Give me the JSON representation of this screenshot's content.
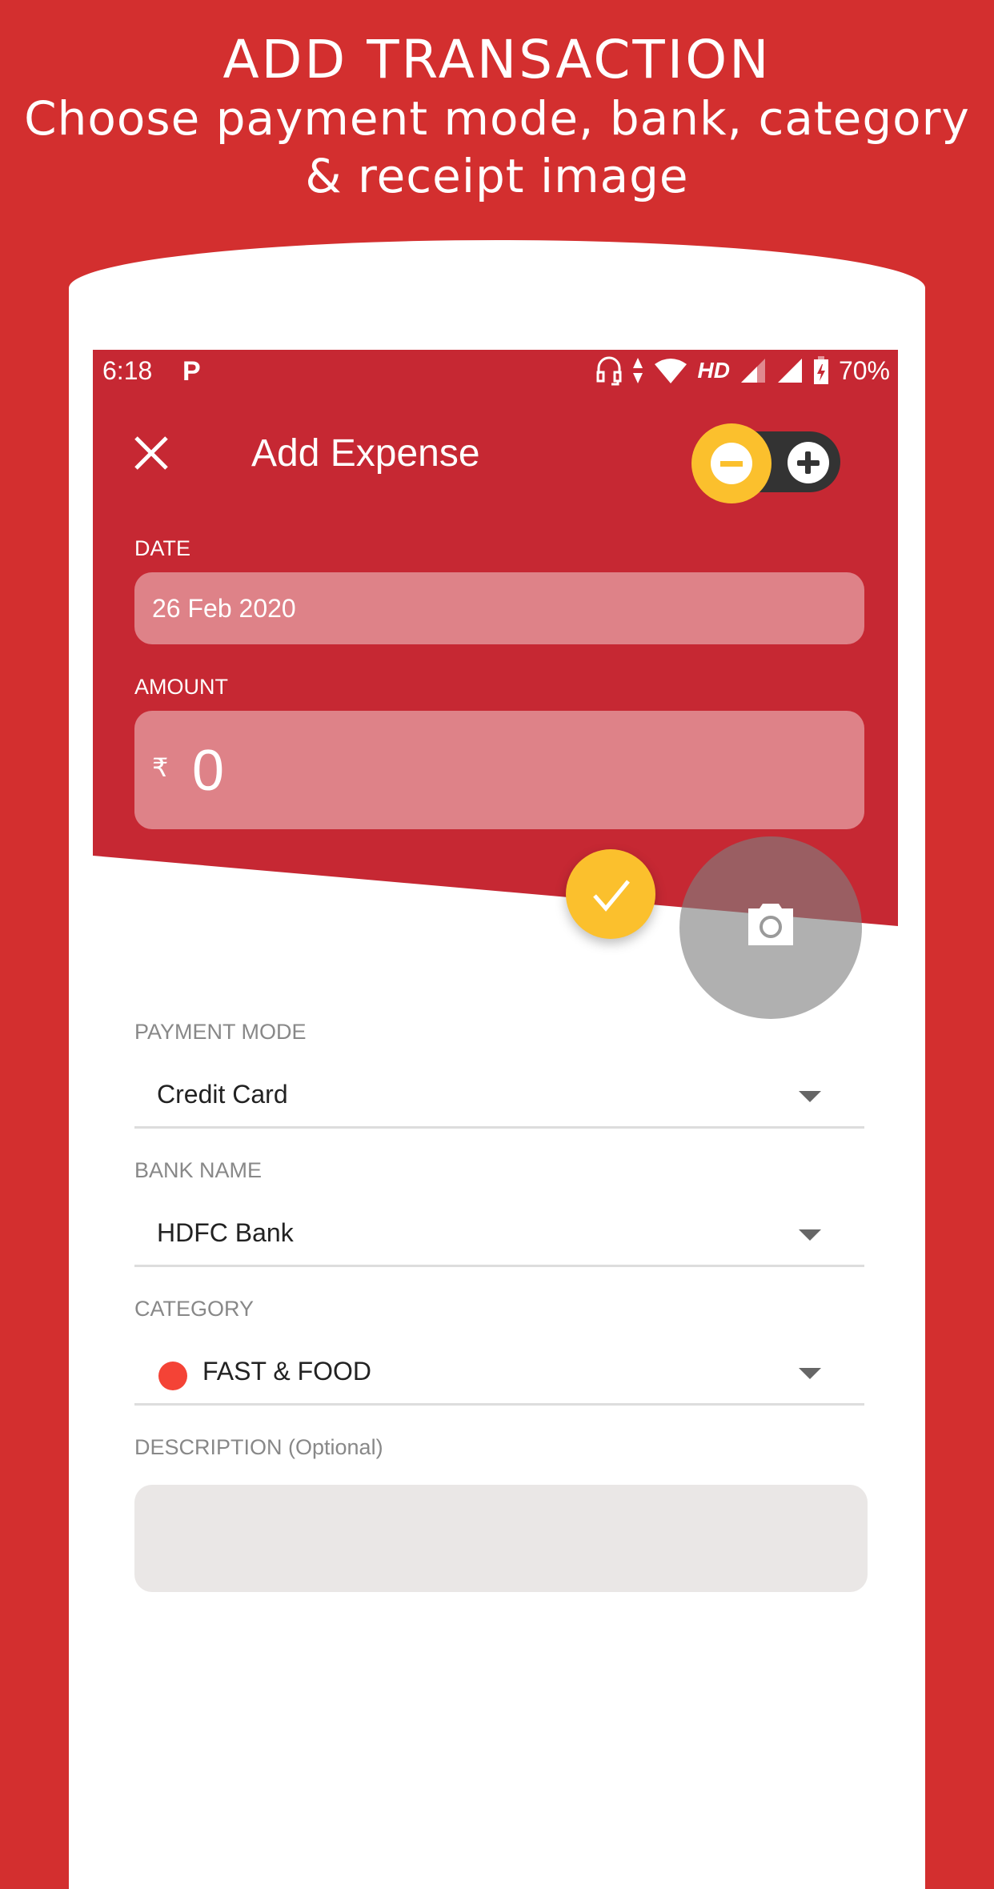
{
  "promo": {
    "title": "ADD TRANSACTION",
    "subtitle_line1": "Choose payment mode, bank, category",
    "subtitle_line2": "& receipt image"
  },
  "status_bar": {
    "time": "6:18",
    "app_icon": "P",
    "hd_label": "HD",
    "battery_percent": "70%",
    "icons": [
      "headset-icon",
      "data-arrows-icon",
      "wifi-icon",
      "hd-icon",
      "signal-icon",
      "signal-icon",
      "battery-charging-icon"
    ]
  },
  "toolbar": {
    "close_icon": "close-icon",
    "title": "Add Expense",
    "type_toggle": {
      "selected": "expense",
      "options": [
        "expense",
        "income"
      ]
    }
  },
  "form": {
    "date": {
      "label": "DATE",
      "value": "26 Feb 2020"
    },
    "amount": {
      "label": "AMOUNT",
      "currency_symbol": "₹",
      "value": "0"
    },
    "payment_mode": {
      "label": "PAYMENT MODE",
      "value": "Credit Card"
    },
    "bank_name": {
      "label": "BANK NAME",
      "value": "HDFC Bank"
    },
    "category": {
      "label": "CATEGORY",
      "value": "FAST & FOOD",
      "color": "#f44336"
    },
    "description": {
      "label": "DESCRIPTION (Optional)",
      "value": ""
    }
  },
  "colors": {
    "promo_background": "#d32f2f",
    "header": "#c62833",
    "accent_yellow": "#fbc02d",
    "toggle_dark": "#333333"
  }
}
